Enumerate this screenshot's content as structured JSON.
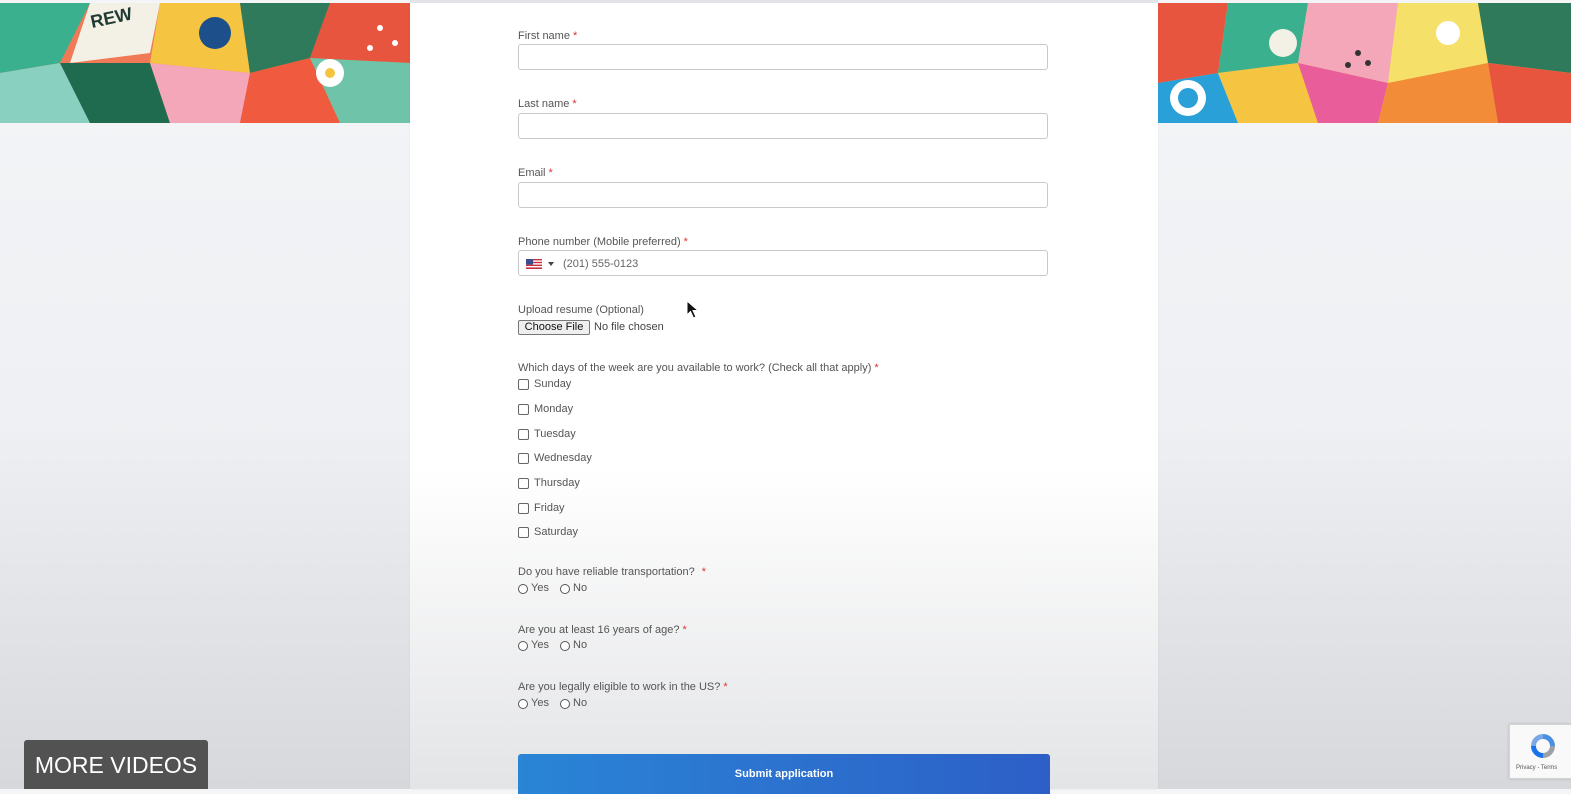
{
  "form": {
    "first_name": {
      "label": "First name",
      "required": "*",
      "value": ""
    },
    "last_name": {
      "label": "Last name",
      "required": "*",
      "value": ""
    },
    "email": {
      "label": "Email",
      "required": "*",
      "value": ""
    },
    "phone": {
      "label": "Phone number (Mobile preferred)",
      "required": "*",
      "placeholder": "(201) 555-0123",
      "country_flag": "us-flag-icon"
    },
    "resume": {
      "label": "Upload resume (Optional)",
      "button_label": "Choose File",
      "status": "No file chosen"
    },
    "days": {
      "label": "Which days of the week are you available to work? (Check all that apply)",
      "required": "*",
      "options": [
        "Sunday",
        "Monday",
        "Tuesday",
        "Wednesday",
        "Thursday",
        "Friday",
        "Saturday"
      ]
    },
    "transportation": {
      "label": "Do you have reliable transportation?",
      "required": "*",
      "options": [
        "Yes",
        "No"
      ]
    },
    "age": {
      "label": "Are you at least 16 years of age?",
      "required": "*",
      "options": [
        "Yes",
        "No"
      ]
    },
    "eligible": {
      "label": "Are you legally eligible to work in the US?",
      "required": "*",
      "options": [
        "Yes",
        "No"
      ]
    },
    "submit_label": "Submit application"
  },
  "overlay": {
    "more_videos_label": "MORE VIDEOS",
    "recaptcha_terms": "Privacy - Terms"
  },
  "colors": {
    "submit_start": "#2a85d6",
    "submit_end": "#2d5fc7",
    "required": "#dd3333"
  }
}
